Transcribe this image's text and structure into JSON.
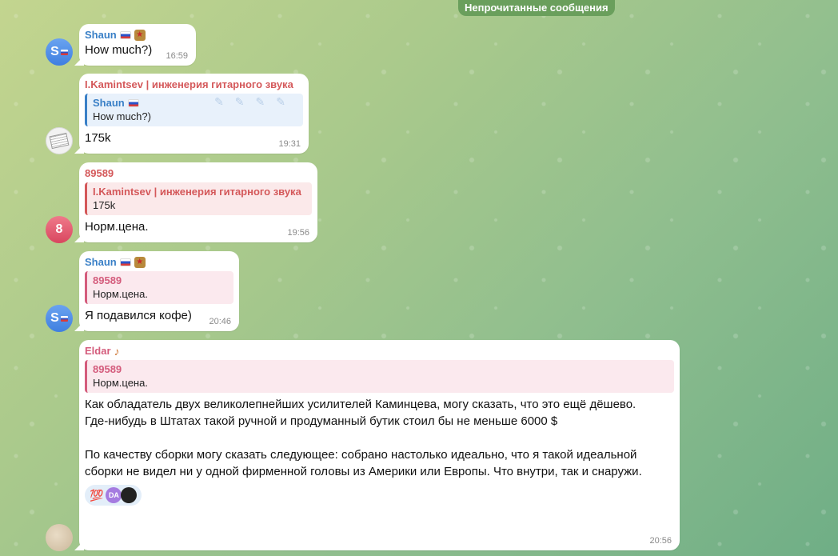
{
  "unread_label": "Непрочитанные сообщения",
  "colors": {
    "accent_blue": "#3a80c7",
    "accent_red": "#d4585a",
    "accent_pink": "#d45c7c"
  },
  "messages": [
    {
      "sender": "Shaun",
      "text": "How much?)",
      "time": "16:59",
      "avatar_letter": "S"
    },
    {
      "sender": "I.Kamintsev | инженерия гитарного звука",
      "reply": {
        "sender": "Shaun",
        "text": "How much?)"
      },
      "text": "175k",
      "time": "19:31"
    },
    {
      "sender": "89589",
      "reply": {
        "sender": "I.Kamintsev | инженерия гитарного звука",
        "text": "175k"
      },
      "text": "Норм.цена.",
      "time": "19:56",
      "avatar_letter": "8"
    },
    {
      "sender": "Shaun",
      "reply": {
        "sender": "89589",
        "text": "Норм.цена."
      },
      "text": "Я подавился кофе)",
      "time": "20:46",
      "avatar_letter": "S"
    },
    {
      "sender": "Eldar",
      "reply": {
        "sender": "89589",
        "text": "Норм.цена."
      },
      "text": "Как обладатель двух великолепнейших усилителей Каминцева, могу сказать, что это ещё дёшево.\nГде-нибудь в Штатах такой ручной и продуманный бутик стоил бы не меньше 6000 $\n\nПо качеству сборки могу сказать следующее: собрано настолько идеально, что я такой идеальной сборки не видел ни у одной фирменной головы из Америки или Европы. Что внутри, так и снаружи.",
      "time": "20:56",
      "reactions": [
        {
          "emoji": "💯",
          "avatars": [
            "DA",
            ""
          ]
        }
      ]
    }
  ]
}
